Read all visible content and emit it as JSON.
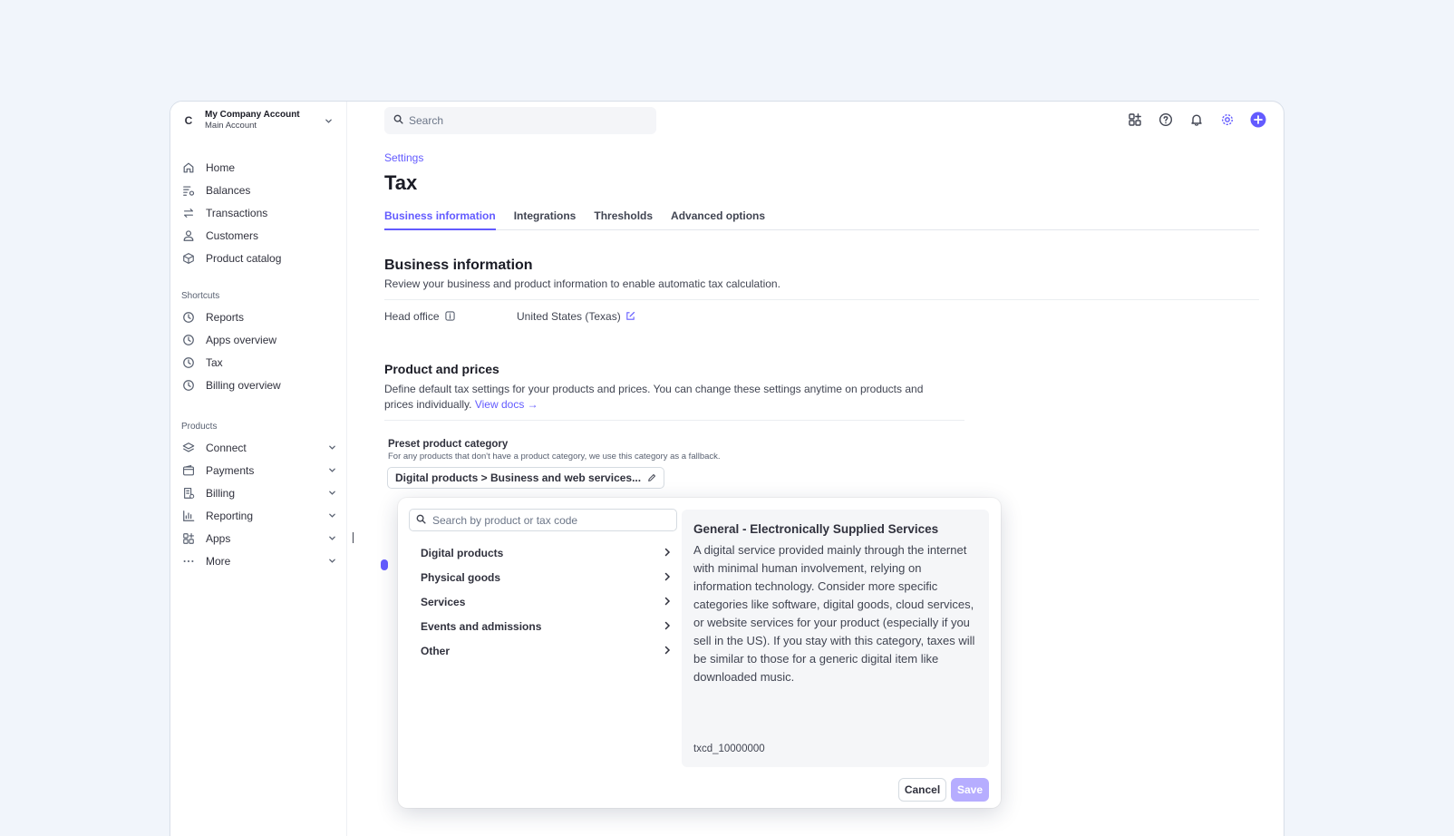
{
  "account": {
    "initial": "C",
    "name": "My Company Account",
    "sub": "Main Account"
  },
  "nav": {
    "main": [
      {
        "label": "Home",
        "icon": "home-icon"
      },
      {
        "label": "Balances",
        "icon": "balances-icon"
      },
      {
        "label": "Transactions",
        "icon": "transactions-icon"
      },
      {
        "label": "Customers",
        "icon": "customer-icon"
      },
      {
        "label": "Product catalog",
        "icon": "box-icon"
      }
    ],
    "shortcuts_label": "Shortcuts",
    "shortcuts": [
      {
        "label": "Reports"
      },
      {
        "label": "Apps overview"
      },
      {
        "label": "Tax"
      },
      {
        "label": "Billing overview"
      }
    ],
    "products_label": "Products",
    "products": [
      {
        "label": "Connect",
        "icon": "layers-icon"
      },
      {
        "label": "Payments",
        "icon": "wallet-icon"
      },
      {
        "label": "Billing",
        "icon": "billing-icon"
      },
      {
        "label": "Reporting",
        "icon": "bar-chart-icon"
      },
      {
        "label": "Apps",
        "icon": "apps-icon"
      },
      {
        "label": "More",
        "icon": "more-icon"
      }
    ]
  },
  "search": {
    "placeholder": "Search"
  },
  "breadcrumb": "Settings",
  "page_title": "Tax",
  "tabs": [
    "Business information",
    "Integrations",
    "Thresholds",
    "Advanced options"
  ],
  "business": {
    "title": "Business information",
    "desc": "Review your business and product information to enable automatic tax calculation.",
    "head_office_label": "Head office",
    "head_office_value": "United States (Texas)"
  },
  "products_prices": {
    "title": "Product and prices",
    "desc": "Define default tax settings for your products and prices. You can change these settings anytime on products and prices individually.",
    "docs_link": "View docs →",
    "preset_label": "Preset product category",
    "preset_help": "For any products that don't have a product category, we use this category as a fallback.",
    "preset_value": "Digital products > Business and web services..."
  },
  "popover": {
    "search_placeholder": "Search by product or tax code",
    "categories": [
      "Digital products",
      "Physical goods",
      "Services",
      "Events and admissions",
      "Other"
    ],
    "detail_title": "General - Electronically Supplied Services",
    "detail_body": "A digital service provided mainly through the internet with minimal human involvement, relying on information technology. Consider more specific categories like software, digital goods, cloud services, or website services for your product (especially if you sell in the US). If you stay with this category, taxes will be similar to those for a generic digital item like downloaded music.",
    "detail_code": "txcd_10000000",
    "cancel_label": "Cancel",
    "save_label": "Save"
  },
  "colors": {
    "accent": "#635bff",
    "save_disabled": "#b6adff",
    "background": "#f1f5fb"
  }
}
